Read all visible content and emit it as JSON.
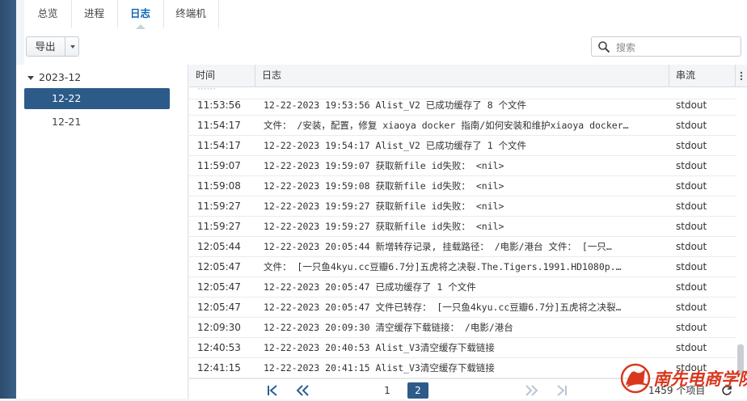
{
  "tabs": [
    {
      "label": "总览",
      "active": false
    },
    {
      "label": "进程",
      "active": false
    },
    {
      "label": "日志",
      "active": true
    },
    {
      "label": "终端机",
      "active": false
    }
  ],
  "toolbar": {
    "export_label": "导出",
    "search_placeholder": "搜索"
  },
  "sidebar": {
    "group": "2023-12",
    "items": [
      {
        "label": "12-22",
        "selected": true
      },
      {
        "label": "12-21",
        "selected": false
      }
    ]
  },
  "grid": {
    "columns": {
      "time": "时间",
      "log": "日志",
      "stream": "串流"
    },
    "rows": [
      {
        "time": "11:53:56",
        "log": "12-22-2023 19:53:56 Alist_V2 已成功缓存了 8 个文件",
        "stream": "stdout"
      },
      {
        "time": "11:54:17",
        "log": "文件： /安装，配置，修复 xiaoya docker 指南/如何安装和维护xiaoya docker…",
        "stream": "stdout"
      },
      {
        "time": "11:54:17",
        "log": "12-22-2023 19:54:17 Alist_V2 已成功缓存了 1 个文件",
        "stream": "stdout"
      },
      {
        "time": "11:59:07",
        "log": "12-22-2023 19:59:07 获取新file id失败： <nil>",
        "stream": "stdout"
      },
      {
        "time": "11:59:08",
        "log": "12-22-2023 19:59:08 获取新file id失败： <nil>",
        "stream": "stdout"
      },
      {
        "time": "11:59:27",
        "log": "12-22-2023 19:59:27 获取新file id失败： <nil>",
        "stream": "stdout"
      },
      {
        "time": "11:59:27",
        "log": "12-22-2023 19:59:27 获取新file id失败： <nil>",
        "stream": "stdout"
      },
      {
        "time": "12:05:44",
        "log": "12-22-2023 20:05:44 新增转存记录, 挂载路径： /电影/港台  文件： [一只…",
        "stream": "stdout"
      },
      {
        "time": "12:05:47",
        "log": "文件： [一只鱼4kyu.cc豆瓣6.7分]五虎将之决裂.The.Tigers.1991.HD1080p.…",
        "stream": "stdout"
      },
      {
        "time": "12:05:47",
        "log": "12-22-2023 20:05:47  已成功缓存了 1 个文件",
        "stream": "stdout"
      },
      {
        "time": "12:05:47",
        "log": "12-22-2023 20:05:47 文件已转存： [一只鱼4kyu.cc豆瓣6.7分]五虎将之决裂…",
        "stream": "stdout"
      },
      {
        "time": "12:09:30",
        "log": "12-22-2023 20:09:30  清空缓存下载链接： /电影/港台",
        "stream": "stdout"
      },
      {
        "time": "12:40:53",
        "log": "12-22-2023 20:40:53  Alist_V3清空缓存下载链接",
        "stream": "stdout"
      },
      {
        "time": "12:41:15",
        "log": "12-22-2023 20:41:15  Alist_V3清空缓存下载链接",
        "stream": "stdout"
      }
    ]
  },
  "pager": {
    "page1": "1",
    "page2": "2",
    "count": "1459 个项目"
  },
  "watermark": {
    "text": "南先电商学院"
  },
  "colors": {
    "accent": "#2c5b8a",
    "tab_active": "#0e66b8",
    "watermark": "#d9381e"
  }
}
